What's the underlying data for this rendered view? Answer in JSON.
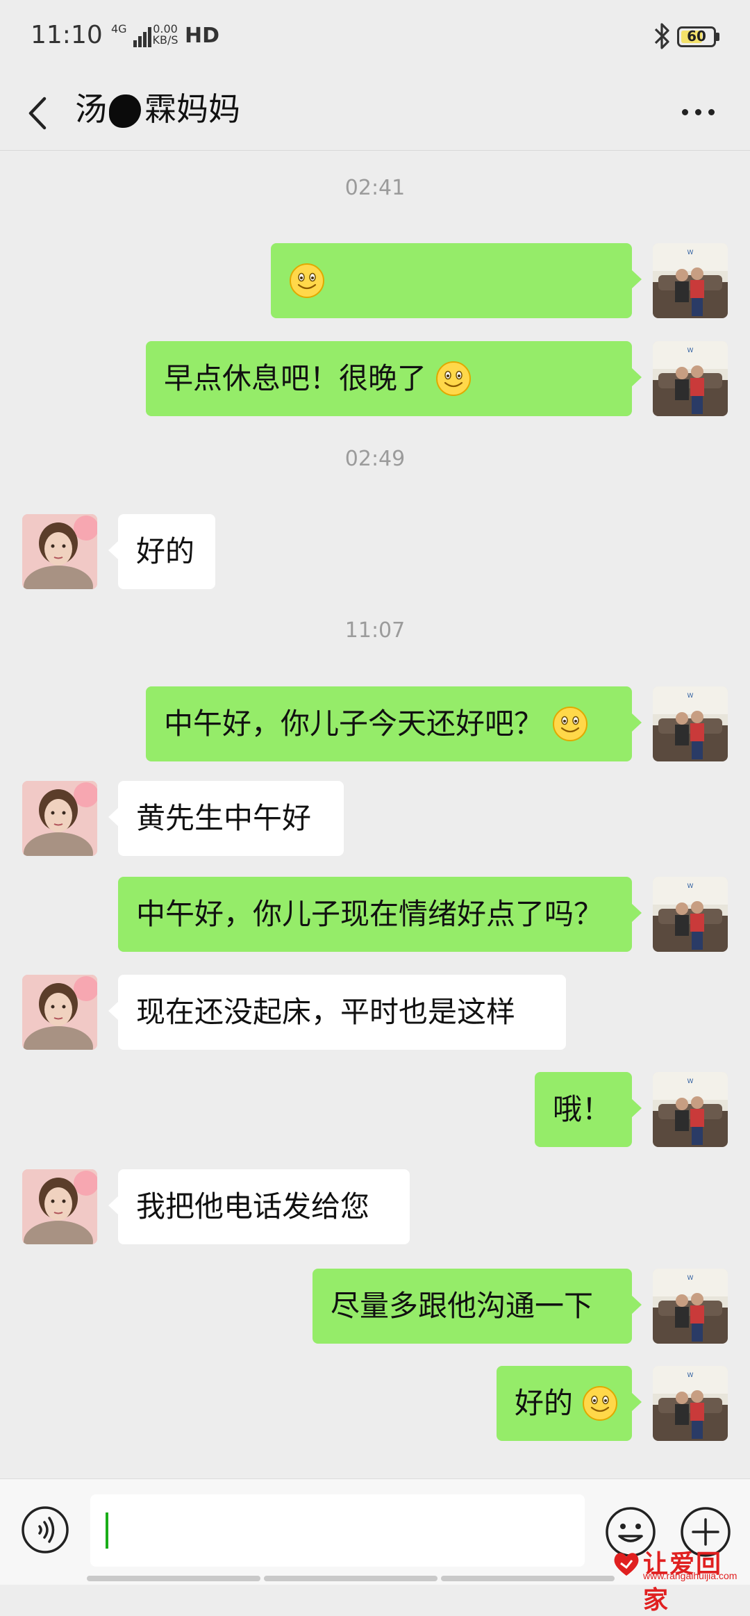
{
  "status_bar": {
    "time": "11:10",
    "network": "4G",
    "speed_value": "0.00",
    "speed_unit": "KB/S",
    "hd": "HD",
    "battery": "60",
    "bluetooth_icon": "bluetooth-icon"
  },
  "header": {
    "title": "汤",
    "title_rest": "霖妈妈",
    "back_icon": "chevron-left-icon",
    "more_icon": "more-dots-icon"
  },
  "messages": [
    {
      "type": "time",
      "text": "02:41"
    },
    {
      "type": "sent",
      "text": "",
      "emoji": "smile"
    },
    {
      "type": "sent",
      "text": "早点休息吧！很晚了",
      "emoji": "smile"
    },
    {
      "type": "time",
      "text": "02:49"
    },
    {
      "type": "received",
      "text": "好的"
    },
    {
      "type": "time",
      "text": "11:07"
    },
    {
      "type": "sent",
      "text": "中午好，你儿子今天还好吧？",
      "emoji": "smile"
    },
    {
      "type": "received",
      "text": "黄先生中午好"
    },
    {
      "type": "sent",
      "text": "中午好，你儿子现在情绪好点了吗？"
    },
    {
      "type": "received",
      "text": "现在还没起床，平时也是这样"
    },
    {
      "type": "sent",
      "text": "哦！"
    },
    {
      "type": "received",
      "text": "我把他电话发给您"
    },
    {
      "type": "sent",
      "text": "尽量多跟他沟通一下"
    },
    {
      "type": "sent",
      "text": "好的",
      "emoji": "smile"
    }
  ],
  "input_bar": {
    "voice_icon": "voice-icon",
    "input_value": "",
    "emoji_icon": "emoji-icon",
    "plus_icon": "plus-icon"
  },
  "watermark": {
    "text": "让爱回家",
    "url": "www.rangaihuijia.com"
  },
  "colors": {
    "background": "#ededed",
    "sent_bubble": "#95ec69",
    "received_bubble": "#ffffff",
    "timestamp": "#9b9b9b"
  }
}
